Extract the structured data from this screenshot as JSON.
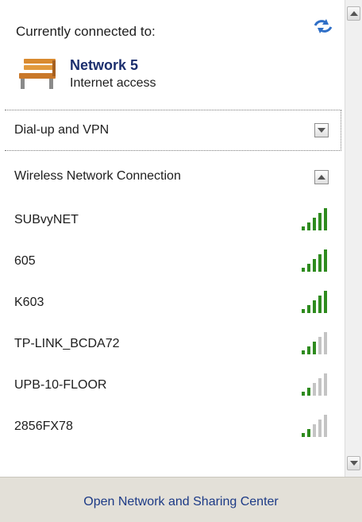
{
  "header": {
    "connected_label": "Currently connected to:",
    "network_name": "Network 5",
    "network_status": "Internet access",
    "refresh_icon": "refresh-icon",
    "network_icon": "bench-icon"
  },
  "sections": {
    "vpn_label": "Dial-up and VPN",
    "vpn_state": "collapsed",
    "wireless_label": "Wireless Network Connection",
    "wireless_state": "expanded"
  },
  "networks": [
    {
      "name": "SUBvyNET",
      "signal_bars": 5
    },
    {
      "name": "605",
      "signal_bars": 5
    },
    {
      "name": "K603",
      "signal_bars": 5
    },
    {
      "name": "TP-LINK_BCDA72",
      "signal_bars": 3
    },
    {
      "name": "UPB-10-FLOOR",
      "signal_bars": 2
    },
    {
      "name": "2856FX78",
      "signal_bars": 2
    }
  ],
  "footer": {
    "link": "Open Network and Sharing Center"
  },
  "colors": {
    "signal_on": "#2e8b1e",
    "signal_off": "#c4c4c4",
    "title_blue": "#1c2f6e",
    "footer_bg": "#e3e0d8"
  }
}
